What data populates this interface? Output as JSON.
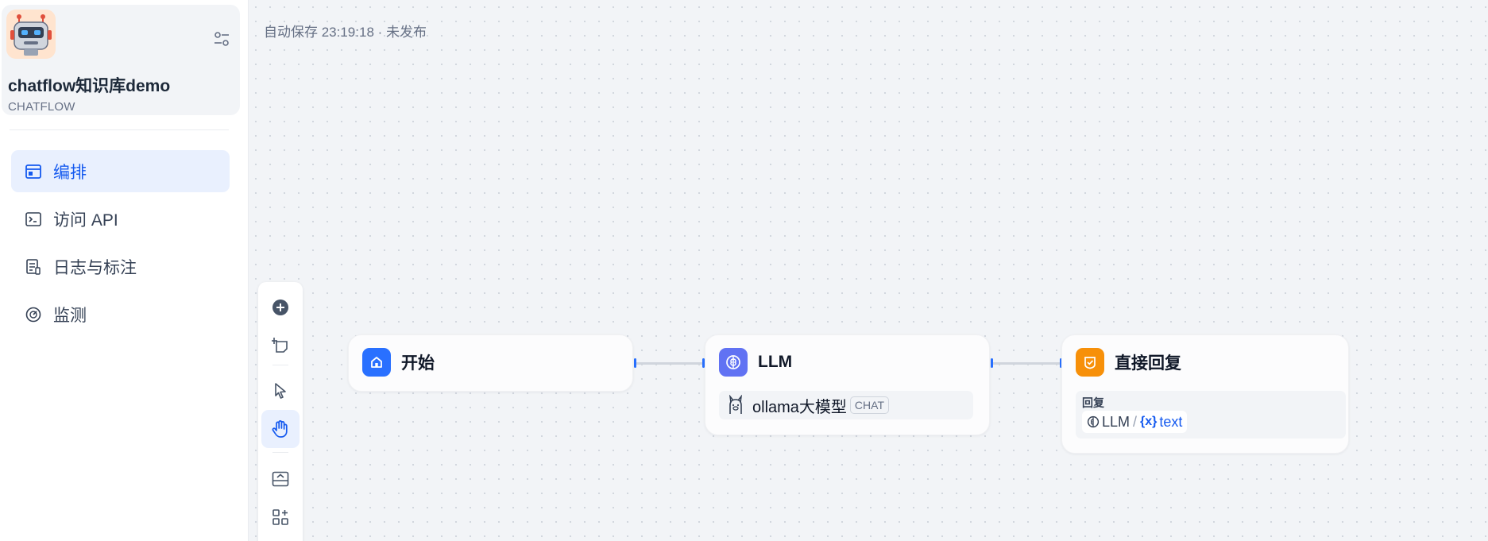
{
  "app": {
    "name": "chatflow知识库demo",
    "type": "CHATFLOW"
  },
  "nav": {
    "items": [
      {
        "label": "编排",
        "icon": "layout-icon",
        "active": true
      },
      {
        "label": "访问 API",
        "icon": "terminal-icon",
        "active": false
      },
      {
        "label": "日志与标注",
        "icon": "log-icon",
        "active": false
      },
      {
        "label": "监测",
        "icon": "gauge-icon",
        "active": false
      }
    ]
  },
  "canvas": {
    "autosave_text": "自动保存 23:19:18 · 未发布"
  },
  "toolbar": {
    "tools": [
      "add-node-icon",
      "add-note-icon",
      "pointer-icon",
      "hand-icon",
      "export-image-icon",
      "organize-icon"
    ],
    "active_tool": "hand-icon"
  },
  "nodes": {
    "start": {
      "title": "开始",
      "icon": "home-icon",
      "color": "#2970ff"
    },
    "llm": {
      "title": "LLM",
      "icon": "brain-icon",
      "color": "#6172f3",
      "model": "ollama大模型",
      "mode": "CHAT"
    },
    "answer": {
      "title": "直接回复",
      "icon": "reply-icon",
      "color": "#f79009",
      "field_label": "回复",
      "var_source": "LLM",
      "var_name": "text",
      "var_symbol": "{x}"
    }
  },
  "colors": {
    "accent": "#155aef",
    "handle": "#2970ff"
  }
}
